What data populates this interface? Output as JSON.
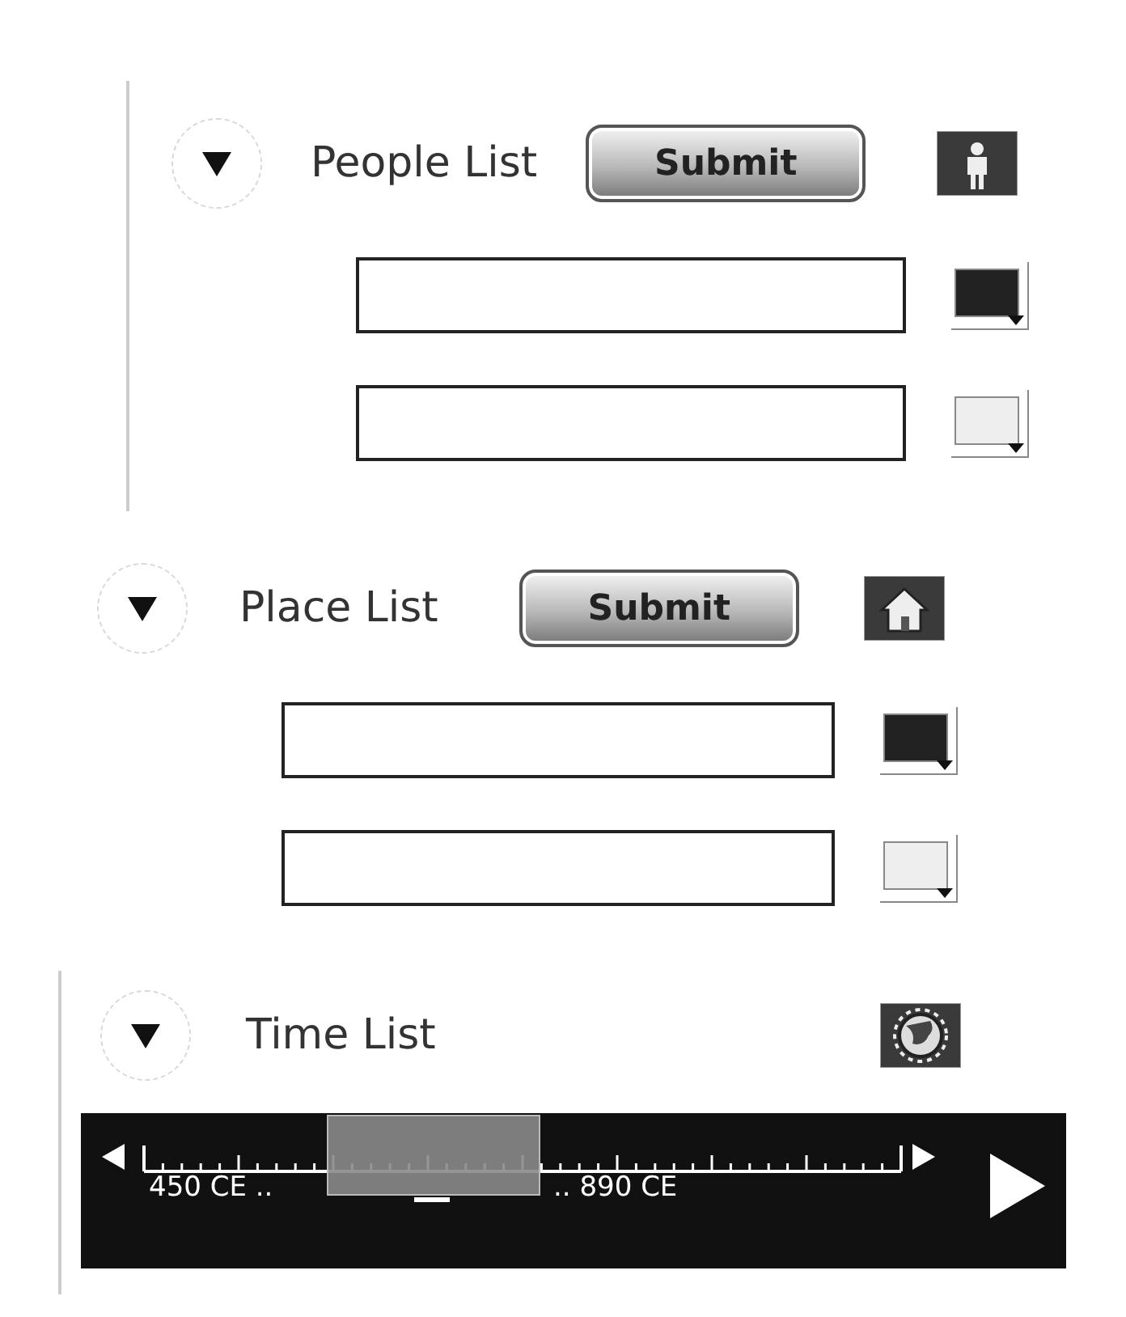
{
  "sections": [
    {
      "kind": "list",
      "title": "People List",
      "expanded": true,
      "submit": "Submit",
      "fields": [
        {
          "color": "#222222"
        },
        {
          "color": "#eeeeee"
        }
      ]
    },
    {
      "kind": "list",
      "title": "Place List",
      "expanded": true,
      "submit": "Submit",
      "fields": [
        {
          "color": "#222222"
        },
        {
          "color": "#eeeeee"
        }
      ]
    },
    {
      "kind": "timeline",
      "title": "Time List",
      "expanded": true,
      "timeline": {
        "start_label": "450 CE ..",
        "end_label": ".. 890 CE"
      }
    }
  ]
}
